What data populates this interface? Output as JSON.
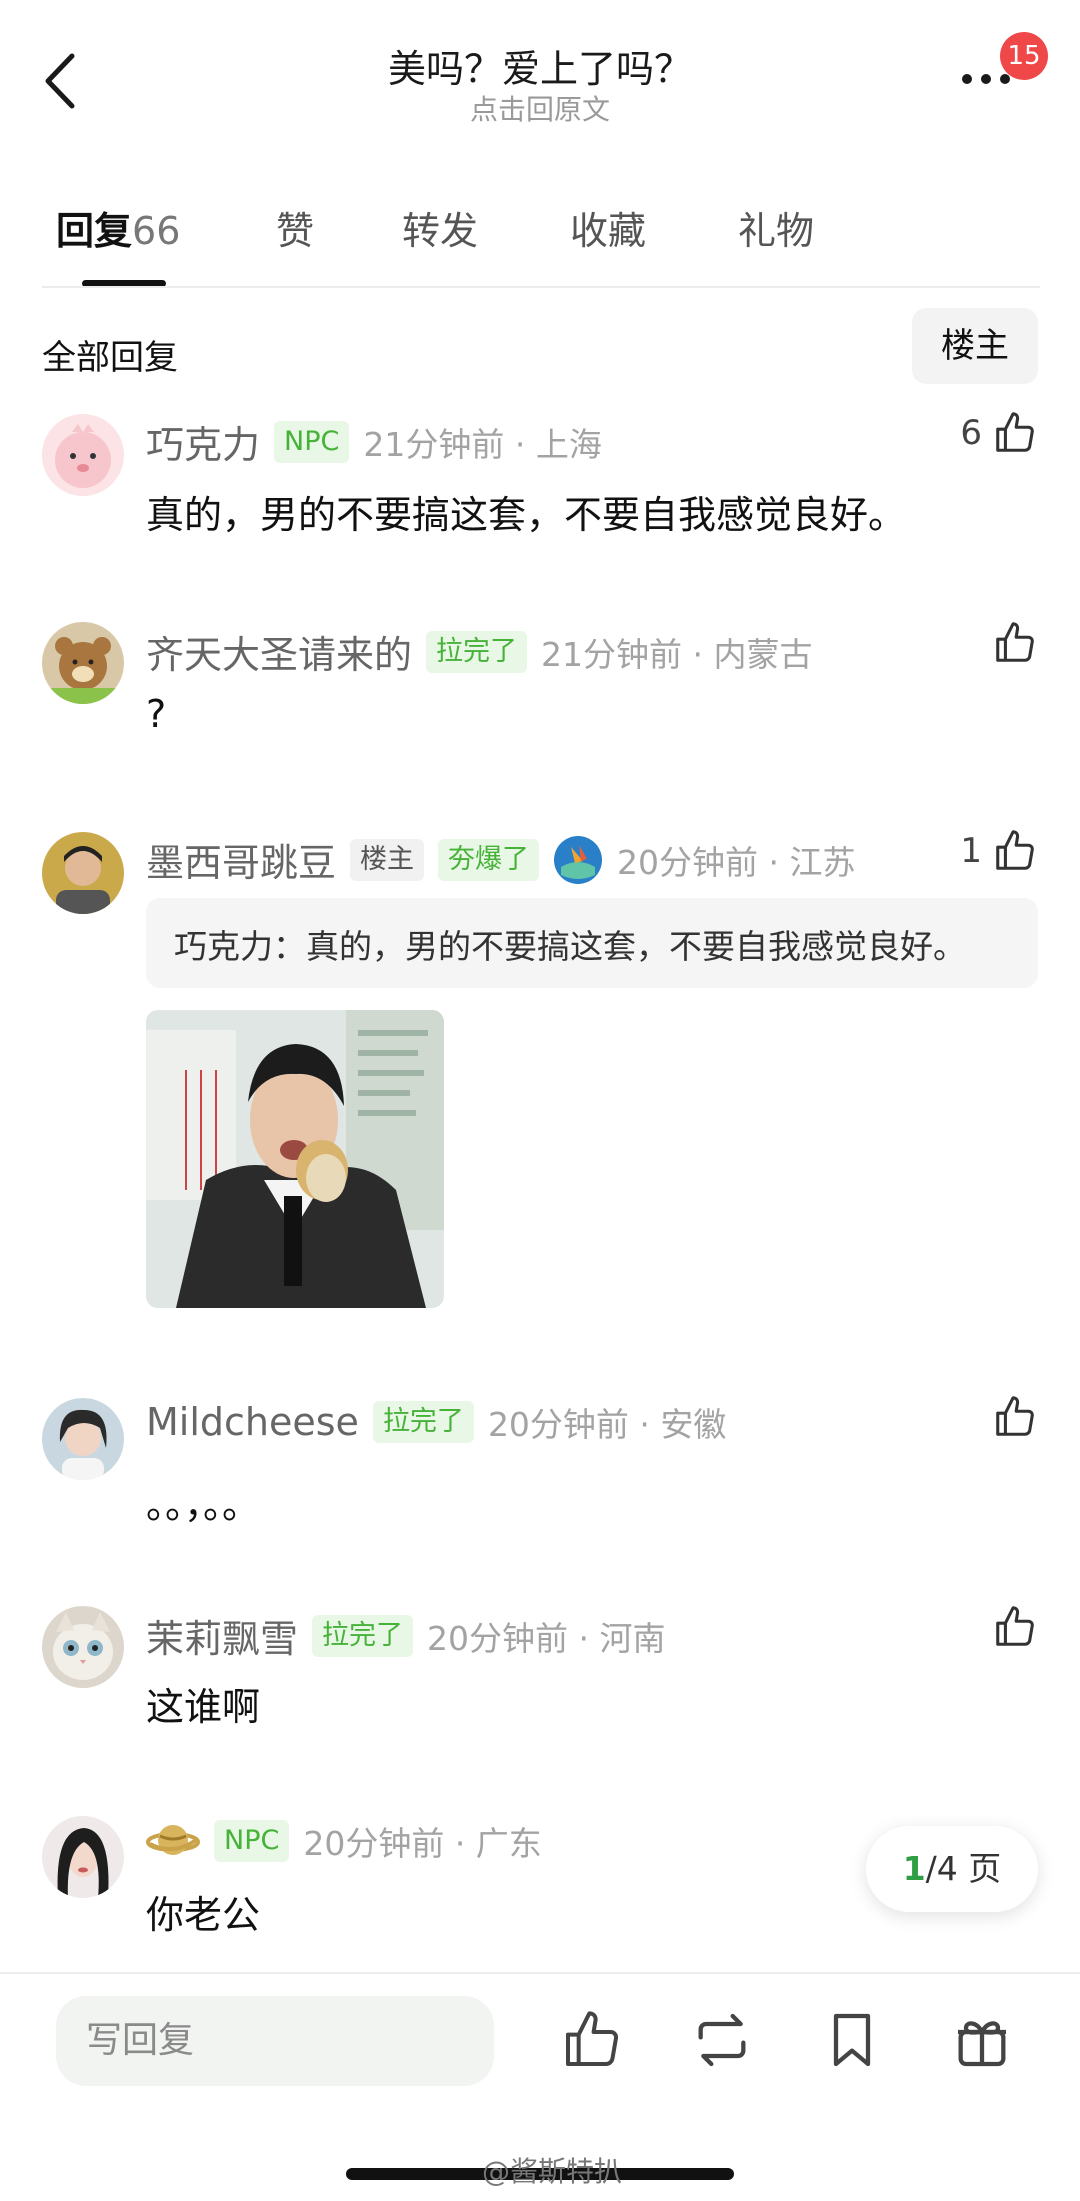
{
  "header": {
    "title": "美吗？爱上了吗？",
    "subtitle": "点击回原文",
    "badge_count": "15"
  },
  "tabs": [
    {
      "label": "回复",
      "count": "66"
    },
    {
      "label": "赞"
    },
    {
      "label": "转发"
    },
    {
      "label": "收藏"
    },
    {
      "label": "礼物"
    }
  ],
  "section": {
    "title": "全部回复",
    "filter_label": "楼主"
  },
  "comments": [
    {
      "user": "巧克力",
      "tag": "NPC",
      "time": "21分钟前 · 上海",
      "text": "真的，男的不要搞这套，不要自我感觉良好。",
      "likes": "6"
    },
    {
      "user": "齐天大圣请来的",
      "tag": "拉完了",
      "time": "21分钟前 · 内蒙古",
      "text": "?"
    },
    {
      "user": "墨西哥跳豆",
      "op_tag": "楼主",
      "tag": "夯爆了",
      "time": "20分钟前 · 江苏",
      "likes": "1",
      "quote": "巧克力：真的，男的不要搞这套，不要自我感觉良好。"
    },
    {
      "user": "Mildcheese",
      "tag": "拉完了",
      "time": "20分钟前 · 安徽",
      "text": "。。，。。"
    },
    {
      "user": "茉莉飘雪",
      "tag": "拉完了",
      "time": "20分钟前 · 河南",
      "text": "这谁啊"
    },
    {
      "tag": "NPC",
      "time": "20分钟前 · 广东",
      "text": "你老公"
    }
  ],
  "page_indicator": {
    "current": "1",
    "total": "/4 页"
  },
  "bottom_bar": {
    "placeholder": "写回复"
  },
  "watermark": "@酱斯特扒",
  "colors": {
    "accent_green": "#46b338",
    "badge_red": "#f04848"
  }
}
